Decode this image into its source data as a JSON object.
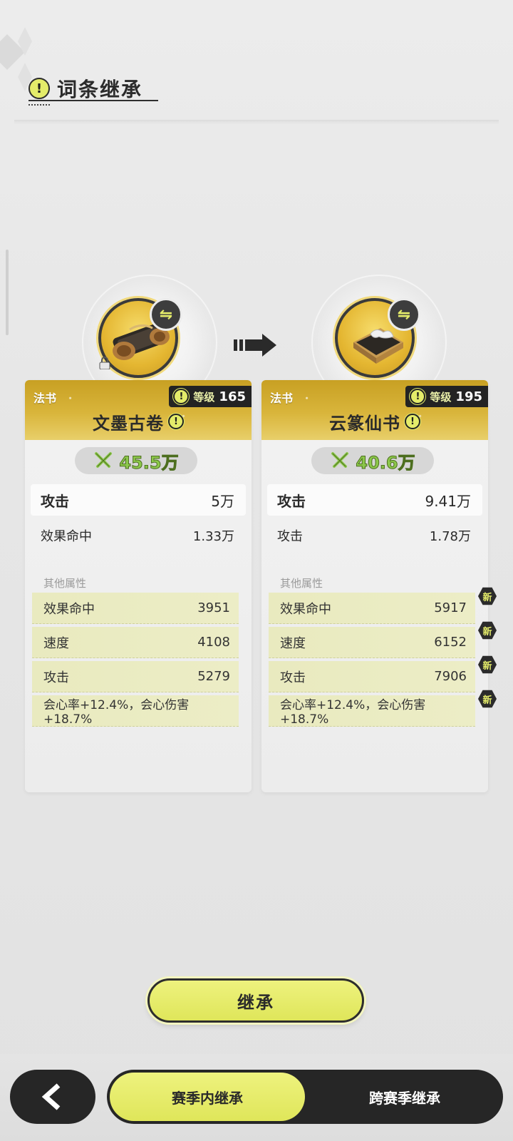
{
  "header": {
    "title": "词条继承",
    "info_icon": "info-icon"
  },
  "source_item": {
    "type": "法书",
    "level_label": "等级",
    "level": "165",
    "name": "文墨古卷",
    "power": "45.5万",
    "locked": true,
    "main_stats": [
      {
        "label": "攻击",
        "value": "5万"
      },
      {
        "label": "效果命中",
        "value": "1.33万"
      }
    ],
    "others_label": "其他属性",
    "extra_stats": [
      {
        "label": "效果命中",
        "value": "3951"
      },
      {
        "label": "速度",
        "value": "4108"
      },
      {
        "label": "攻击",
        "value": "5279"
      },
      {
        "label": "会心率+12.4%，会心伤害+18.7%",
        "value": ""
      }
    ]
  },
  "target_item": {
    "type": "法书",
    "level_label": "等级",
    "level": "195",
    "name": "云篆仙书",
    "power": "40.6万",
    "main_stats": [
      {
        "label": "攻击",
        "value": "9.41万"
      },
      {
        "label": "攻击",
        "value": "1.78万"
      }
    ],
    "others_label": "其他属性",
    "new_badge": "新",
    "extra_stats": [
      {
        "label": "效果命中",
        "value": "5917"
      },
      {
        "label": "速度",
        "value": "6152"
      },
      {
        "label": "攻击",
        "value": "7906"
      },
      {
        "label": "会心率+12.4%，会心伤害+18.7%",
        "value": ""
      }
    ]
  },
  "actions": {
    "inherit_label": "继承"
  },
  "tabs": [
    {
      "label": "赛季内继承",
      "active": true
    },
    {
      "label": "跨赛季继承",
      "active": false
    }
  ],
  "colors": {
    "accent": "#e4ec6a",
    "gold": "#d9b53b",
    "dark": "#262626",
    "power_green": "#8cc84b"
  }
}
